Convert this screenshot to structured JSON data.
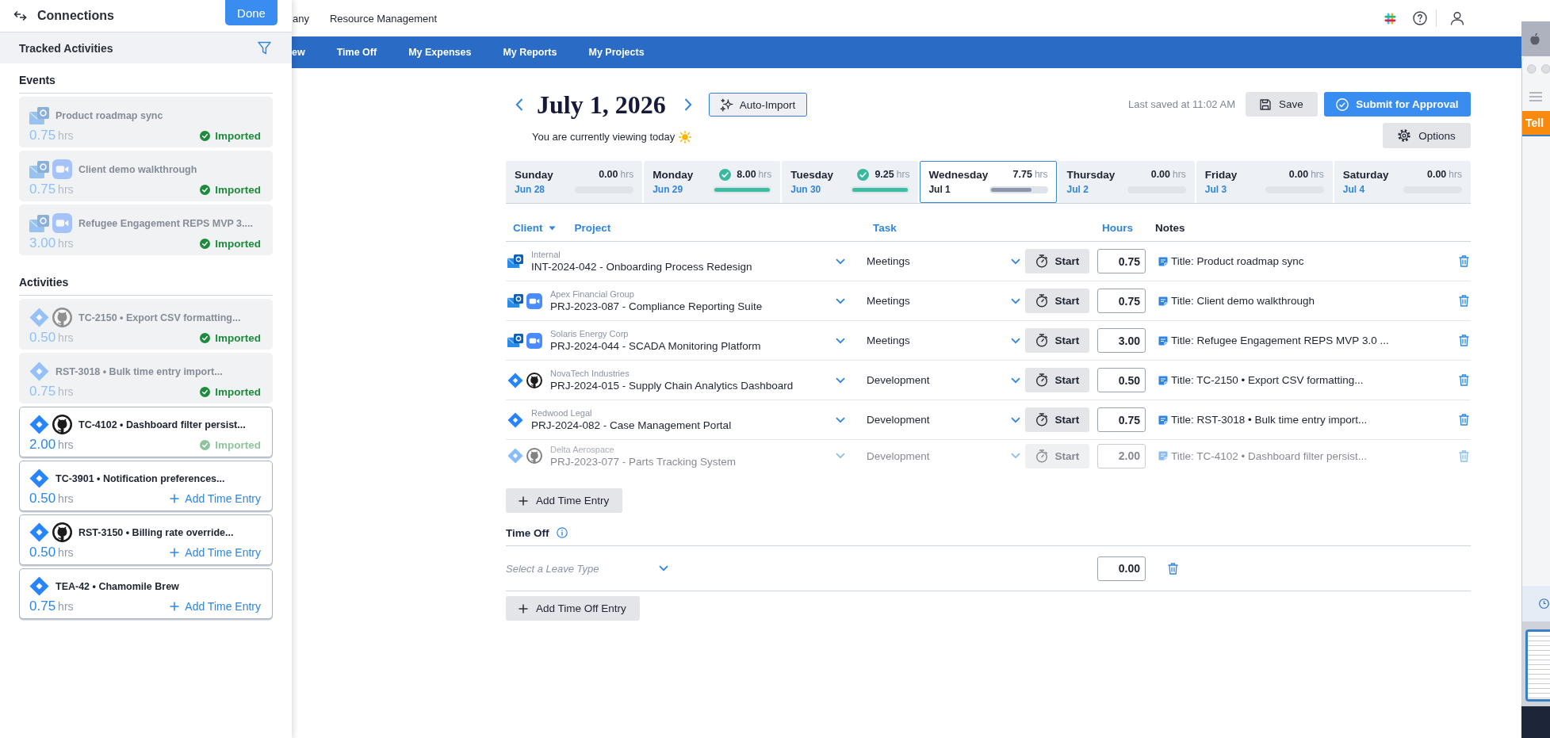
{
  "drawer": {
    "title": "Connections",
    "done": "Done",
    "section_title": "Tracked Activities",
    "groups": [
      {
        "heading": "Events",
        "items": [
          {
            "title": "Product roadmap sync",
            "sources": [
              {
                "kind": "mail"
              }
            ],
            "hours": "0.75",
            "unit": "hrs",
            "kind": "imported",
            "status": "Imported"
          },
          {
            "title": "Client demo walkthrough",
            "sources": [
              {
                "kind": "mail"
              },
              {
                "kind": "video"
              }
            ],
            "hours": "0.75",
            "unit": "hrs",
            "kind": "imported",
            "status": "Imported"
          },
          {
            "title": "Refugee Engagement REPS MVP 3....",
            "sources": [
              {
                "kind": "mail"
              },
              {
                "kind": "video"
              }
            ],
            "hours": "3.00",
            "unit": "hrs",
            "kind": "imported",
            "status": "Imported"
          }
        ]
      },
      {
        "heading": "Activities",
        "items": [
          {
            "title": "TC-2150 • Export CSV formatting...",
            "sources": [
              {
                "kind": "issue"
              },
              {
                "kind": "code"
              }
            ],
            "hours": "0.50",
            "unit": "hrs",
            "kind": "imported",
            "status": "Imported"
          },
          {
            "title": "RST-3018 • Bulk time entry import...",
            "sources": [
              {
                "kind": "issue"
              }
            ],
            "hours": "0.75",
            "unit": "hrs",
            "kind": "imported",
            "status": "Imported"
          },
          {
            "title": "TC-4102 • Dashboard filter persist...",
            "sources": [
              {
                "kind": "issue"
              },
              {
                "kind": "code"
              }
            ],
            "hours": "2.00",
            "unit": "hrs",
            "kind": "importing",
            "status": "Imported"
          },
          {
            "title": "TC-3901 • Notification preferences...",
            "sources": [
              {
                "kind": "issue"
              }
            ],
            "hours": "0.50",
            "unit": "hrs",
            "kind": "pending",
            "status": "Add Time Entry"
          },
          {
            "title": "RST-3150 • Billing rate override...",
            "sources": [
              {
                "kind": "issue"
              },
              {
                "kind": "code"
              }
            ],
            "hours": "0.50",
            "unit": "hrs",
            "kind": "pending",
            "status": "Add Time Entry"
          },
          {
            "title": "TEA-42 • Chamomile Brew",
            "sources": [
              {
                "kind": "issue"
              }
            ],
            "hours": "0.75",
            "unit": "hrs",
            "kind": "pending",
            "status": "Add Time Entry"
          }
        ]
      }
    ]
  },
  "top_bar": {
    "links": [
      "any",
      "Resource Management"
    ]
  },
  "nav": {
    "items": [
      "ew",
      "Time Off",
      "My Expenses",
      "My Reports",
      "My Projects"
    ]
  },
  "timesheet": {
    "date": "July 1, 2026",
    "auto_import": "Auto-Import",
    "today_note": "You are currently viewing today",
    "last_saved": "Last saved at 11:02 AM",
    "save": "Save",
    "submit": "Submit for Approval",
    "options": "Options",
    "days": [
      {
        "name": "Sunday",
        "date": "Jun 28",
        "hours": "0.00",
        "unit": "hrs",
        "complete": false,
        "level": 0,
        "selected": false
      },
      {
        "name": "Monday",
        "date": "Jun 29",
        "hours": "8.00",
        "unit": "hrs",
        "complete": true,
        "level": 1,
        "selected": false
      },
      {
        "name": "Tuesday",
        "date": "Jun 30",
        "hours": "9.25",
        "unit": "hrs",
        "complete": true,
        "level": 1,
        "selected": false
      },
      {
        "name": "Wednesday",
        "date": "Jul 1",
        "hours": "7.75",
        "unit": "hrs",
        "complete": false,
        "level": 0.74,
        "selected": true
      },
      {
        "name": "Thursday",
        "date": "Jul 2",
        "hours": "0.00",
        "unit": "hrs",
        "complete": false,
        "level": 0,
        "selected": false
      },
      {
        "name": "Friday",
        "date": "Jul 3",
        "hours": "0.00",
        "unit": "hrs",
        "complete": false,
        "level": 0,
        "selected": false
      },
      {
        "name": "Saturday",
        "date": "Jul 4",
        "hours": "0.00",
        "unit": "hrs",
        "complete": false,
        "level": 0,
        "selected": false
      }
    ],
    "columns": [
      {
        "label": "Client",
        "sortable": true,
        "sorted": true
      },
      {
        "label": "Project",
        "sortable": true,
        "sorted": false
      },
      {
        "label": "Task",
        "sortable": true,
        "sorted": false
      },
      {
        "label": "Hours",
        "sortable": true,
        "sorted": false
      },
      {
        "label": "Notes",
        "sortable": false,
        "sorted": false
      }
    ],
    "rows": [
      {
        "sources": [
          {
            "kind": "mail"
          }
        ],
        "client": "Internal",
        "project": "INT-2024-042 - Onboarding Process Redesign",
        "task": "Meetings",
        "start": "Start",
        "hours": "0.75",
        "notes": "Title: Product roadmap sync",
        "faded": false
      },
      {
        "sources": [
          {
            "kind": "mail"
          },
          {
            "kind": "video"
          }
        ],
        "client": "Apex Financial Group",
        "project": "PRJ-2023-087 - Compliance Reporting Suite",
        "task": "Meetings",
        "start": "Start",
        "hours": "0.75",
        "notes": "Title: Client demo walkthrough",
        "faded": false
      },
      {
        "sources": [
          {
            "kind": "mail"
          },
          {
            "kind": "video"
          }
        ],
        "client": "Solaris Energy Corp",
        "project": "PRJ-2024-044 - SCADA Monitoring Platform",
        "task": "Meetings",
        "start": "Start",
        "hours": "3.00",
        "notes": "Title: Refugee Engagement REPS MVP 3.0 ...",
        "faded": false
      },
      {
        "sources": [
          {
            "kind": "issue"
          },
          {
            "kind": "code"
          }
        ],
        "client": "NovaTech Industries",
        "project": "PRJ-2024-015 - Supply Chain Analytics Dashboard",
        "task": "Development",
        "start": "Start",
        "hours": "0.50",
        "notes": "Title: TC-2150 • Export CSV formatting...",
        "faded": false
      },
      {
        "sources": [
          {
            "kind": "issue"
          }
        ],
        "client": "Redwood Legal",
        "project": "PRJ-2024-082 - Case Management Portal",
        "task": "Development",
        "start": "Start",
        "hours": "0.75",
        "notes": "Title: RST-3018 • Bulk time entry import...",
        "faded": false
      },
      {
        "sources": [
          {
            "kind": "issue"
          },
          {
            "kind": "code"
          }
        ],
        "client": "Delta Aerospace",
        "project": "PRJ-2023-077 - Parts Tracking System",
        "task": "Development",
        "start": "Start",
        "hours": "2.00",
        "notes": "Title: TC-4102 • Dashboard filter persist...",
        "faded": true
      }
    ],
    "add_entry": "Add Time Entry",
    "time_off": {
      "title": "Time Off",
      "rows": [
        {
          "placeholder": "Select a Leave Type",
          "hours": "0.00"
        }
      ],
      "add_entry": "Add Time Off Entry"
    }
  },
  "background_window": {
    "button": "Tell"
  }
}
